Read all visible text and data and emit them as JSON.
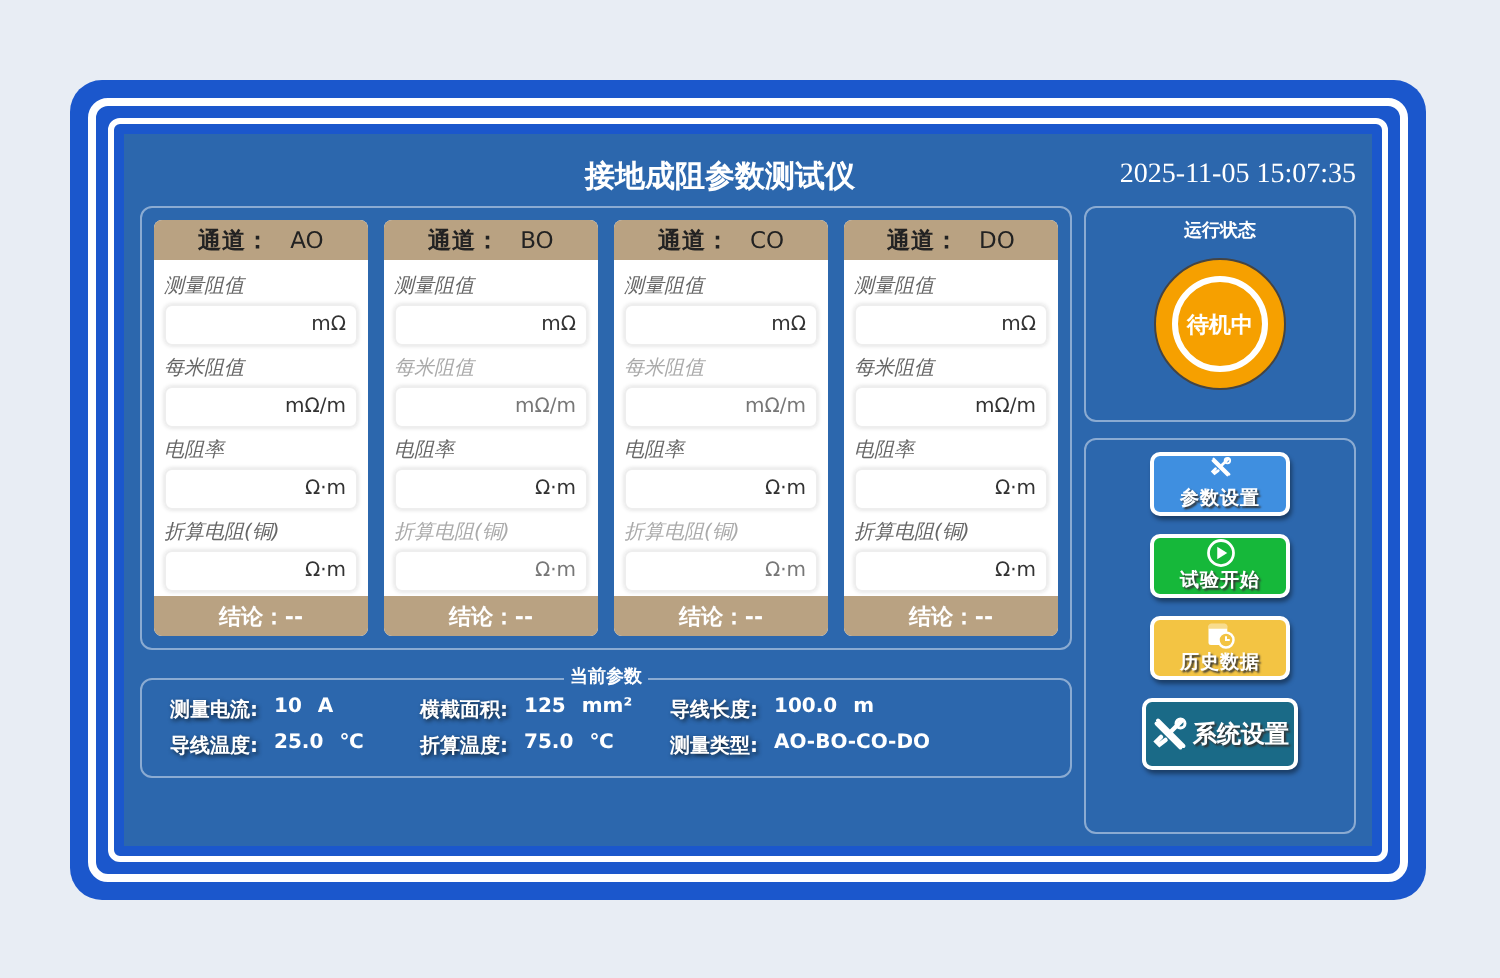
{
  "window": {
    "title": "接地成阻参数测试仪",
    "datetime": "2025-11-05 15:07:35"
  },
  "channels": [
    {
      "label": "通道：",
      "name": "AO",
      "conclusion": "结论：--",
      "fields": [
        {
          "label": "测量阻值",
          "unit": "mΩ",
          "disabled": false
        },
        {
          "label": "每米阻值",
          "unit": "mΩ/m",
          "disabled": false
        },
        {
          "label": "电阻率",
          "unit": "Ω·m",
          "disabled": false
        },
        {
          "label": "折算电阻(铜)",
          "unit": "Ω·m",
          "disabled": false
        }
      ]
    },
    {
      "label": "通道：",
      "name": "BO",
      "conclusion": "结论：--",
      "fields": [
        {
          "label": "测量阻值",
          "unit": "mΩ",
          "disabled": false
        },
        {
          "label": "每米阻值",
          "unit": "mΩ/m",
          "disabled": true
        },
        {
          "label": "电阻率",
          "unit": "Ω·m",
          "disabled": false
        },
        {
          "label": "折算电阻(铜)",
          "unit": "Ω·m",
          "disabled": true
        }
      ]
    },
    {
      "label": "通道：",
      "name": "CO",
      "conclusion": "结论：--",
      "fields": [
        {
          "label": "测量阻值",
          "unit": "mΩ",
          "disabled": false
        },
        {
          "label": "每米阻值",
          "unit": "mΩ/m",
          "disabled": true
        },
        {
          "label": "电阻率",
          "unit": "Ω·m",
          "disabled": false
        },
        {
          "label": "折算电阻(铜)",
          "unit": "Ω·m",
          "disabled": true
        }
      ]
    },
    {
      "label": "通道：",
      "name": "DO",
      "conclusion": "结论：--",
      "fields": [
        {
          "label": "测量阻值",
          "unit": "mΩ",
          "disabled": false
        },
        {
          "label": "每米阻值",
          "unit": "mΩ/m",
          "disabled": false
        },
        {
          "label": "电阻率",
          "unit": "Ω·m",
          "disabled": false
        },
        {
          "label": "折算电阻(铜)",
          "unit": "Ω·m",
          "disabled": false
        }
      ]
    }
  ],
  "params": {
    "title": "当前参数",
    "items": [
      {
        "label": "测量电流:",
        "value": "10",
        "unit": "A"
      },
      {
        "label": "横截面积:",
        "value": "125",
        "unit": "mm²"
      },
      {
        "label": "导线长度:",
        "value": "100.0",
        "unit": "m"
      },
      {
        "label": "导线温度:",
        "value": "25.0",
        "unit": "℃"
      },
      {
        "label": "折算温度:",
        "value": "75.0",
        "unit": "℃"
      },
      {
        "label": "测量类型:",
        "value": "AO-BO-CO-DO"
      }
    ]
  },
  "status": {
    "title": "运行状态",
    "state": "待机中"
  },
  "buttons": [
    {
      "kind": "params",
      "label": "参数设置"
    },
    {
      "kind": "start",
      "label": "试验开始"
    },
    {
      "kind": "history",
      "label": "历史数据"
    },
    {
      "kind": "system",
      "label": "系统设置"
    }
  ]
}
